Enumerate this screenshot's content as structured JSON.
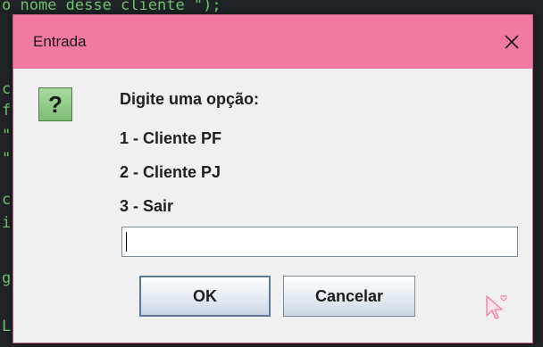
{
  "background": {
    "code_lines": [
      "o nome desse cliente \");",
      "c",
      "f",
      "\"",
      "\"",
      "c",
      "i",
      "g",
      "L"
    ]
  },
  "dialog": {
    "title": "Entrada",
    "close_symbol": "×",
    "icon_glyph": "?",
    "prompt": "Digite uma opção:",
    "options": [
      {
        "number": "1",
        "label": " - Cliente PF"
      },
      {
        "number": "2",
        "label": " - Cliente PJ"
      },
      {
        "number": "3",
        "label": " - Sair"
      }
    ],
    "input_value": "",
    "ok_label": "OK",
    "cancel_label": "Cancelar"
  },
  "colors": {
    "titlebar": "#f07aa0",
    "dialog_bg": "#f0f0f0",
    "cursor_pink": "#f38db2"
  },
  "icons": {
    "question": "question-icon",
    "close": "close-icon",
    "cursor": "pink-pointer-cursor-icon"
  }
}
